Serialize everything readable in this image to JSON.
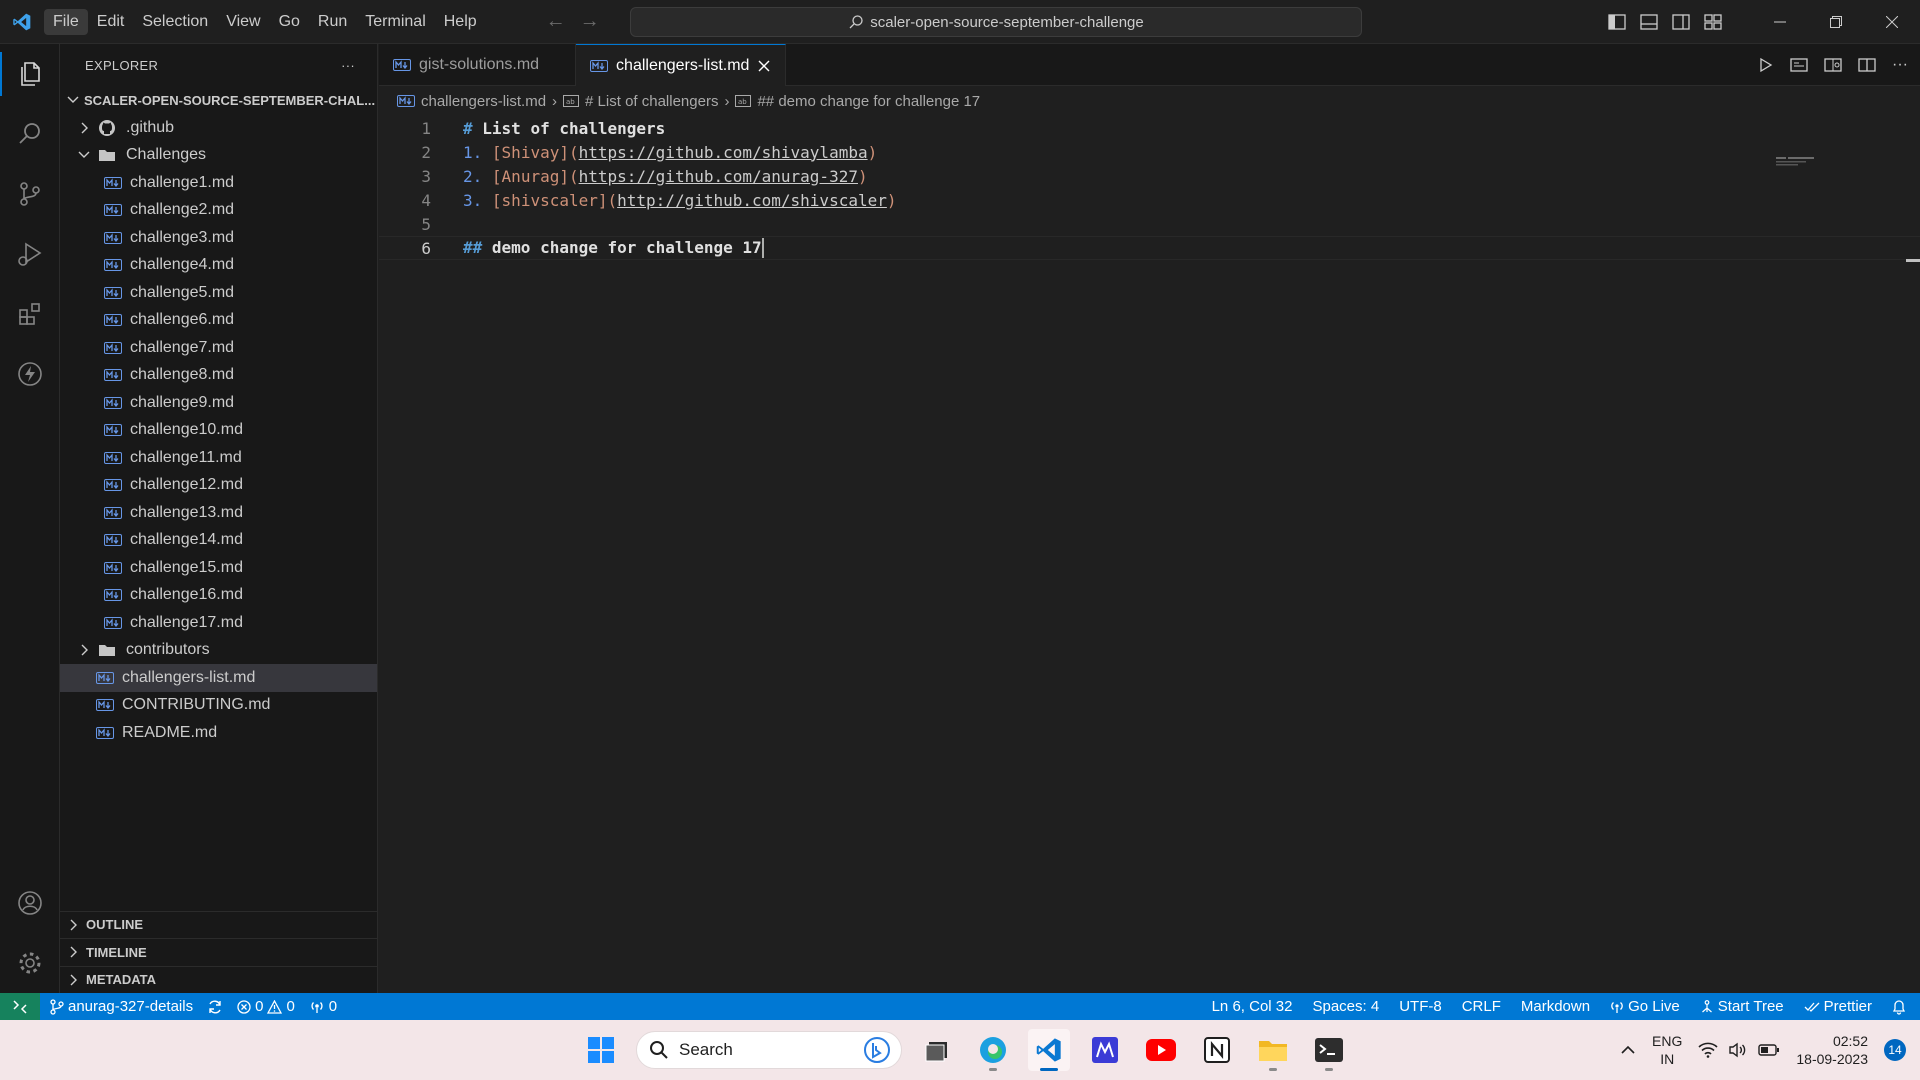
{
  "titlebar": {
    "menu": [
      "File",
      "Edit",
      "Selection",
      "View",
      "Go",
      "Run",
      "Terminal",
      "Help"
    ],
    "search_text": "scaler-open-source-september-challenge"
  },
  "sidebar": {
    "title": "EXPLORER",
    "more": "···",
    "root_folder": "SCALER-OPEN-SOURCE-SEPTEMBER-CHAL...",
    "items": [
      {
        "label": ".github",
        "type": "folder-collapsed",
        "depth": 1,
        "icon": "github-icon"
      },
      {
        "label": "Challenges",
        "type": "folder-open",
        "depth": 1,
        "icon": "folder-icon"
      },
      {
        "label": "challenge1.md",
        "type": "file",
        "depth": 2
      },
      {
        "label": "challenge2.md",
        "type": "file",
        "depth": 2
      },
      {
        "label": "challenge3.md",
        "type": "file",
        "depth": 2
      },
      {
        "label": "challenge4.md",
        "type": "file",
        "depth": 2
      },
      {
        "label": "challenge5.md",
        "type": "file",
        "depth": 2
      },
      {
        "label": "challenge6.md",
        "type": "file",
        "depth": 2
      },
      {
        "label": "challenge7.md",
        "type": "file",
        "depth": 2
      },
      {
        "label": "challenge8.md",
        "type": "file",
        "depth": 2
      },
      {
        "label": "challenge9.md",
        "type": "file",
        "depth": 2
      },
      {
        "label": "challenge10.md",
        "type": "file",
        "depth": 2
      },
      {
        "label": "challenge11.md",
        "type": "file",
        "depth": 2
      },
      {
        "label": "challenge12.md",
        "type": "file",
        "depth": 2
      },
      {
        "label": "challenge13.md",
        "type": "file",
        "depth": 2
      },
      {
        "label": "challenge14.md",
        "type": "file",
        "depth": 2
      },
      {
        "label": "challenge15.md",
        "type": "file",
        "depth": 2
      },
      {
        "label": "challenge16.md",
        "type": "file",
        "depth": 2
      },
      {
        "label": "challenge17.md",
        "type": "file",
        "depth": 2
      },
      {
        "label": "contributors",
        "type": "folder-collapsed",
        "depth": 1,
        "icon": "folder-icon"
      },
      {
        "label": "challengers-list.md",
        "type": "file",
        "depth": 1,
        "selected": true
      },
      {
        "label": "CONTRIBUTING.md",
        "type": "file",
        "depth": 1
      },
      {
        "label": "README.md",
        "type": "file",
        "depth": 1
      }
    ],
    "panels": [
      "OUTLINE",
      "TIMELINE",
      "METADATA"
    ]
  },
  "editor": {
    "tabs": [
      {
        "label": "gist-solutions.md",
        "active": false
      },
      {
        "label": "challengers-list.md",
        "active": true
      }
    ],
    "breadcrumb": [
      "challengers-list.md",
      "# List of challengers",
      "## demo change for challenge 17"
    ],
    "line_numbers": [
      "1",
      "2",
      "3",
      "4",
      "5",
      "6"
    ],
    "lines": {
      "l1_mark": "#",
      "l1_text": "List of challengers",
      "l2_num": "1.",
      "l2_name": "Shivay",
      "l2_url": "https://github.com/shivaylamba",
      "l3_num": "2.",
      "l3_name": "Anurag",
      "l3_url": "https://github.com/anurag-327",
      "l4_num": "3.",
      "l4_name": "shivscaler",
      "l4_url": "http://github.com/shivscaler",
      "l6_mark": "##",
      "l6_text": "demo change for challenge 17"
    }
  },
  "statusbar": {
    "branch": "anurag-327-details",
    "errors": "0",
    "warnings": "0",
    "ports": "0",
    "position": "Ln 6, Col 32",
    "spaces": "Spaces: 4",
    "encoding": "UTF-8",
    "eol": "CRLF",
    "language": "Markdown",
    "golive": "Go Live",
    "starttree": "Start Tree",
    "prettier": "Prettier"
  },
  "taskbar": {
    "search_placeholder": "Search",
    "lang_top": "ENG",
    "lang_bottom": "IN",
    "time": "02:52",
    "date": "18-09-2023",
    "notifications": "14"
  },
  "colors": {
    "accent": "#0078d4",
    "remote": "#16825d",
    "heading_mark": "#569cd6",
    "link_text": "#ce9178"
  }
}
